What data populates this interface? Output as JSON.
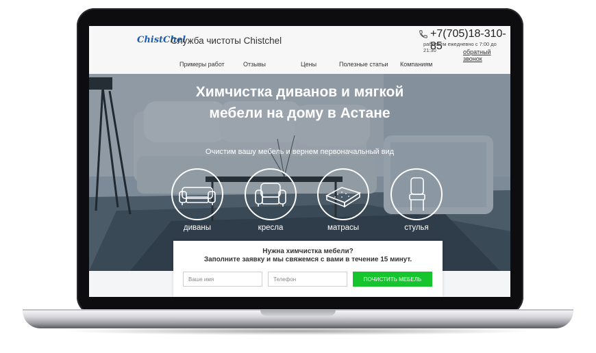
{
  "header": {
    "logo_text": "ChistChel",
    "site_title": "Служба чистоты Chistchel",
    "phone": "+7(705)18-310-85",
    "hours": "работаем ежедневно с 7:00 до 21:30",
    "callback_label": "обратный звонок"
  },
  "nav": {
    "items": [
      {
        "label": "Примеры работ"
      },
      {
        "label": "Отзывы"
      },
      {
        "label": "Цены"
      },
      {
        "label": "Полезные статьи"
      },
      {
        "label": "Компаниям"
      }
    ]
  },
  "hero": {
    "title_line1": "Химчистка диванов и мягкой",
    "title_line2": "мебели на дому в Астане",
    "subtitle": "Очистим вашу мебель и вернем первоначальный вид",
    "categories": [
      {
        "label": "диваны",
        "icon": "sofa-icon"
      },
      {
        "label": "кресла",
        "icon": "armchair-icon"
      },
      {
        "label": "матрасы",
        "icon": "mattress-icon"
      },
      {
        "label": "стулья",
        "icon": "chair-icon"
      }
    ]
  },
  "form": {
    "title_line1": "Нужна химчистка мебели?",
    "title_line2": "Заполните заявку и мы свяжемся с вами в течение 15 минут.",
    "name_placeholder": "Ваше имя",
    "phone_placeholder": "Телефон",
    "submit_label": "ПОЧИСТИТЬ МЕБЕЛЬ"
  },
  "colors": {
    "brand_blue": "#1d5fb4",
    "submit_green": "#16c42e",
    "laptop_bezel": "#0d0d0f"
  }
}
